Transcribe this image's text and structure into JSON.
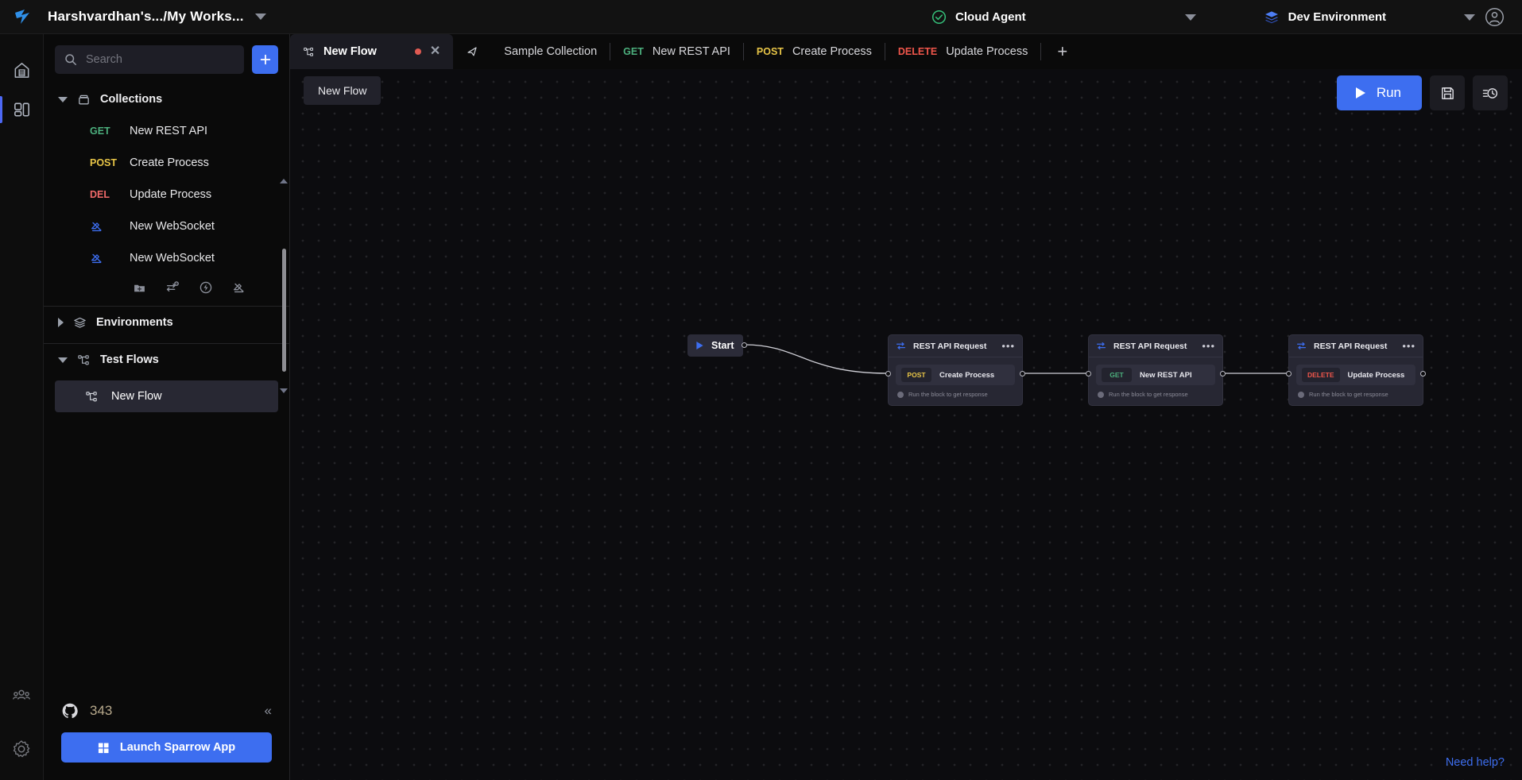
{
  "topbar": {
    "logo_icon": "sparrow-bird-logo",
    "workspace_name": "Harshvardhan's.../My Works...",
    "workspace_caret_icon": "chevron-down-icon",
    "agent": {
      "icon": "check-circle-icon",
      "label": "Cloud Agent",
      "caret_icon": "chevron-down-icon"
    },
    "environment": {
      "icon": "layers-icon",
      "label": "Dev Environment",
      "caret_icon": "chevron-down-icon"
    },
    "avatar_icon": "user-avatar-icon"
  },
  "rail": {
    "items": [
      {
        "icon": "home-icon",
        "name": "home",
        "active": false
      },
      {
        "icon": "collections-grid-icon",
        "name": "workspace",
        "active": true
      }
    ],
    "bottom_items": [
      {
        "icon": "team-users-icon",
        "name": "team"
      },
      {
        "icon": "gear-icon",
        "name": "settings"
      }
    ]
  },
  "sidebar": {
    "search": {
      "placeholder": "Search",
      "value": "",
      "icon": "search-icon"
    },
    "add_button": {
      "icon": "plus-icon",
      "label": "+"
    },
    "collections": {
      "label": "Collections",
      "icon": "collection-box-icon",
      "expanded": true,
      "items": [
        {
          "verb": "GET",
          "verb_class": "get",
          "label": "New REST API"
        },
        {
          "verb": "POST",
          "verb_class": "post",
          "label": "Create Process"
        },
        {
          "verb": "DEL",
          "verb_class": "del",
          "label": "Update Process"
        },
        {
          "verb": "",
          "verb_class": "ws",
          "label": "New WebSocket",
          "icon": "websocket-icon"
        },
        {
          "verb": "",
          "verb_class": "ws",
          "label": "New WebSocket",
          "icon": "websocket-icon"
        }
      ],
      "actions": [
        {
          "icon": "add-folder-icon",
          "name": "add-folder"
        },
        {
          "icon": "add-request-icon",
          "name": "add-request"
        },
        {
          "icon": "add-flow-icon",
          "name": "add-flow"
        },
        {
          "icon": "add-websocket-icon",
          "name": "add-websocket"
        }
      ]
    },
    "environments": {
      "label": "Environments",
      "icon": "layers-icon",
      "expanded": false
    },
    "test_flows": {
      "label": "Test Flows",
      "icon": "flow-nodes-icon",
      "expanded": true,
      "items": [
        {
          "label": "New Flow",
          "icon": "flow-nodes-icon",
          "selected": true
        }
      ]
    },
    "footer": {
      "github_icon": "github-icon",
      "github_count": "343",
      "collapse_icon": "chevron-double-left-icon",
      "launch_button": {
        "label": "Launch Sparrow App",
        "icon": "windows-icon"
      }
    }
  },
  "tabs": [
    {
      "icon": "flow-nodes-icon",
      "label": "New Flow",
      "active": true,
      "modified": true,
      "close_icon": "close-icon"
    },
    {
      "icon": "send-collection-icon",
      "label": "Sample Collection",
      "active": false
    },
    {
      "verb": "GET",
      "verb_class": "get",
      "label": "New REST API",
      "active": false
    },
    {
      "verb": "POST",
      "verb_class": "post",
      "label": "Create Process",
      "active": false
    },
    {
      "verb": "DELETE",
      "verb_class": "delete",
      "label": "Update Process",
      "active": false
    }
  ],
  "tab_add_icon": "plus-icon",
  "canvas": {
    "flow_title": "New Flow",
    "run_button": {
      "label": "Run",
      "icon": "play-icon"
    },
    "save_button": {
      "icon": "save-disk-icon"
    },
    "history_button": {
      "icon": "history-clock-icon"
    },
    "need_help": "Need help?",
    "start_node": {
      "label": "Start",
      "icon": "play-icon"
    },
    "nodes": [
      {
        "title": "REST API Request",
        "icon": "http-exchange-icon",
        "menu_icon": "more-horizontal-icon",
        "verb": "POST",
        "verb_class": "post",
        "request_name": "Create Process",
        "hint": "Run the block to get response"
      },
      {
        "title": "REST API Request",
        "icon": "http-exchange-icon",
        "menu_icon": "more-horizontal-icon",
        "verb": "GET",
        "verb_class": "get",
        "request_name": "New REST API",
        "hint": "Run the block to get response"
      },
      {
        "title": "REST API Request",
        "icon": "http-exchange-icon",
        "menu_icon": "more-horizontal-icon",
        "verb": "DELETE",
        "verb_class": "delete",
        "request_name": "Update Process",
        "hint": "Run the block to get response"
      }
    ]
  },
  "colors": {
    "accent_blue": "#3d6ef0",
    "get_green": "#4caf7d",
    "post_yellow": "#e8c547",
    "delete_red": "#f0564b",
    "canvas_bg": "#0c0c0f",
    "panel_bg": "#272733"
  }
}
